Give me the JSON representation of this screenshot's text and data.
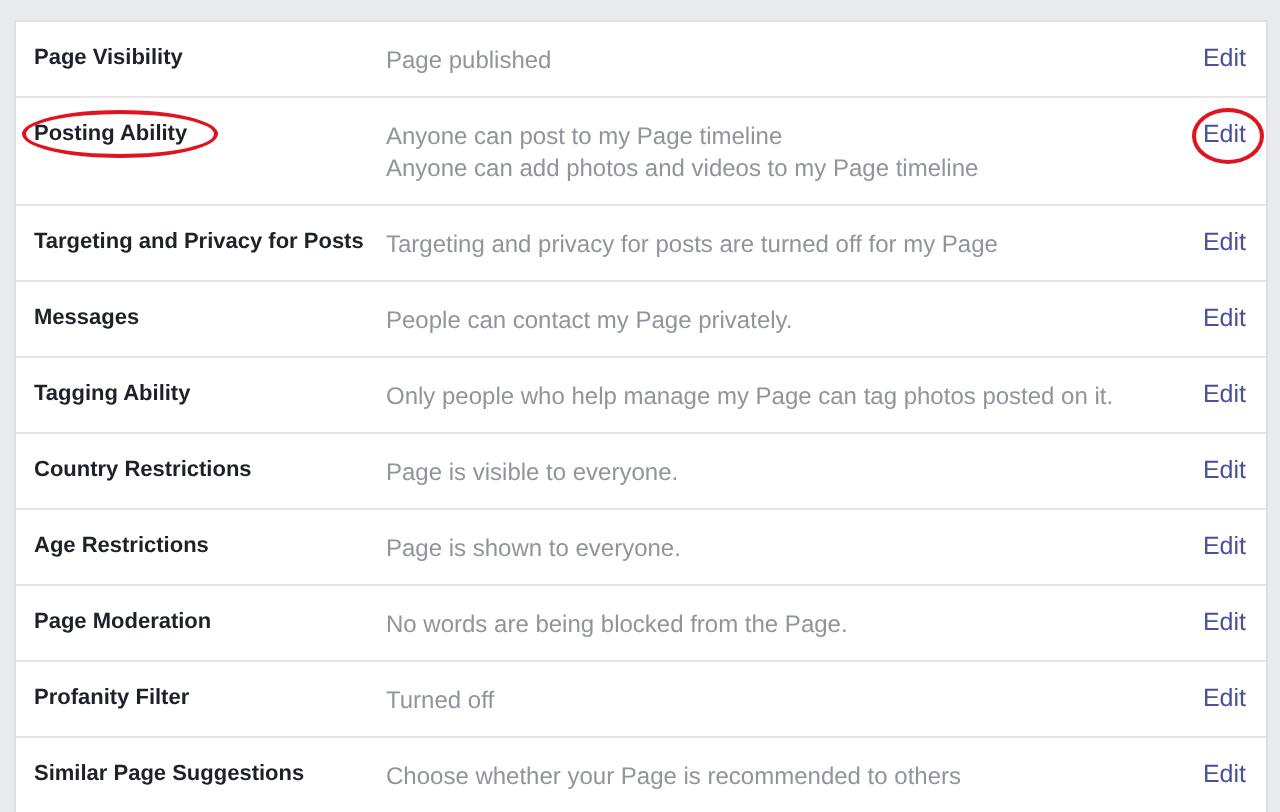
{
  "settings": [
    {
      "label": "Page Visibility",
      "values": [
        "Page published"
      ],
      "action": "Edit",
      "label_circled": false,
      "action_circled": false
    },
    {
      "label": "Posting Ability",
      "values": [
        "Anyone can post to my Page timeline",
        "Anyone can add photos and videos to my Page timeline"
      ],
      "action": "Edit",
      "label_circled": true,
      "action_circled": true
    },
    {
      "label": "Targeting and Privacy for Posts",
      "values": [
        "Targeting and privacy for posts are turned off for my Page"
      ],
      "action": "Edit",
      "label_circled": false,
      "action_circled": false
    },
    {
      "label": "Messages",
      "values": [
        "People can contact my Page privately."
      ],
      "action": "Edit",
      "label_circled": false,
      "action_circled": false
    },
    {
      "label": "Tagging Ability",
      "values": [
        "Only people who help manage my Page can tag photos posted on it."
      ],
      "action": "Edit",
      "label_circled": false,
      "action_circled": false
    },
    {
      "label": "Country Restrictions",
      "values": [
        "Page is visible to everyone."
      ],
      "action": "Edit",
      "label_circled": false,
      "action_circled": false
    },
    {
      "label": "Age Restrictions",
      "values": [
        "Page is shown to everyone."
      ],
      "action": "Edit",
      "label_circled": false,
      "action_circled": false
    },
    {
      "label": "Page Moderation",
      "values": [
        "No words are being blocked from the Page."
      ],
      "action": "Edit",
      "label_circled": false,
      "action_circled": false
    },
    {
      "label": "Profanity Filter",
      "values": [
        "Turned off"
      ],
      "action": "Edit",
      "label_circled": false,
      "action_circled": false
    },
    {
      "label": "Similar Page Suggestions",
      "values": [
        "Choose whether your Page is recommended to others"
      ],
      "action": "Edit",
      "label_circled": false,
      "action_circled": false
    }
  ]
}
